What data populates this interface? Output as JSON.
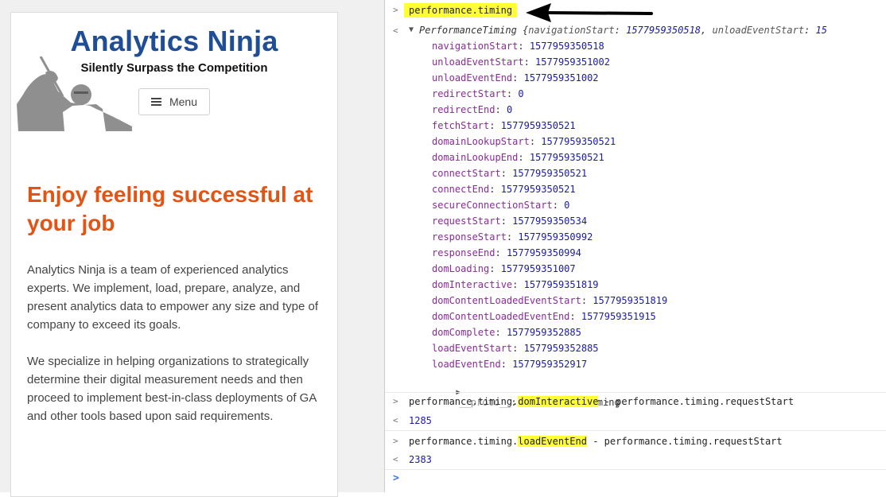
{
  "site": {
    "title": "Analytics Ninja",
    "tagline": "Silently Surpass the Competition",
    "menu_label": "Menu",
    "headline": "Enjoy feeling successful at your job",
    "paragraphs": [
      "Analytics Ninja is a team of experienced analytics experts. We implement, load, prepare, analyze, and present analytics data to empower any size and type of company to exceed its goals.",
      "We specialize in helping organizations to strategically determine their digital measurement needs and then proceed to implement best-in-class deployments of GA and other tools based upon said requirements."
    ],
    "colors": {
      "title": "#1f4e96",
      "headline": "#e35414"
    }
  },
  "console": {
    "command1": "performance.timing",
    "object_type": "PerformanceTiming",
    "summary_keys": [
      "navigationStart",
      "unloadEventStart"
    ],
    "summary_values": [
      "1577959350518",
      "15"
    ],
    "properties": [
      {
        "key": "navigationStart",
        "value": "1577959350518"
      },
      {
        "key": "unloadEventStart",
        "value": "1577959351002"
      },
      {
        "key": "unloadEventEnd",
        "value": "1577959351002"
      },
      {
        "key": "redirectStart",
        "value": "0"
      },
      {
        "key": "redirectEnd",
        "value": "0"
      },
      {
        "key": "fetchStart",
        "value": "1577959350521"
      },
      {
        "key": "domainLookupStart",
        "value": "1577959350521"
      },
      {
        "key": "domainLookupEnd",
        "value": "1577959350521"
      },
      {
        "key": "connectStart",
        "value": "1577959350521"
      },
      {
        "key": "connectEnd",
        "value": "1577959350521"
      },
      {
        "key": "secureConnectionStart",
        "value": "0"
      },
      {
        "key": "requestStart",
        "value": "1577959350534"
      },
      {
        "key": "responseStart",
        "value": "1577959350992"
      },
      {
        "key": "responseEnd",
        "value": "1577959350994"
      },
      {
        "key": "domLoading",
        "value": "1577959351007"
      },
      {
        "key": "domInteractive",
        "value": "1577959351819"
      },
      {
        "key": "domContentLoadedEventStart",
        "value": "1577959351819"
      },
      {
        "key": "domContentLoadedEventEnd",
        "value": "1577959351915"
      },
      {
        "key": "domComplete",
        "value": "1577959352885"
      },
      {
        "key": "loadEventStart",
        "value": "1577959352885"
      },
      {
        "key": "loadEventEnd",
        "value": "1577959352917"
      }
    ],
    "proto_key": "__proto__",
    "proto_value": "PerformanceTiming",
    "command2": {
      "prefix": "performance.timing.",
      "highlight": "domInteractive",
      "suffix": " - performance.timing.requestStart"
    },
    "result2": "1285",
    "command3": {
      "prefix": "performance.timing.",
      "highlight": "loadEventEnd",
      "suffix": " - performance.timing.requestStart"
    },
    "result3": "2383",
    "highlight_color": "#ffff33"
  },
  "icons": {
    "menu": "hamburger-icon",
    "logo": "ninja-silhouette",
    "callout": "black-arrow-left",
    "prompt": "chevron-right-icon"
  }
}
